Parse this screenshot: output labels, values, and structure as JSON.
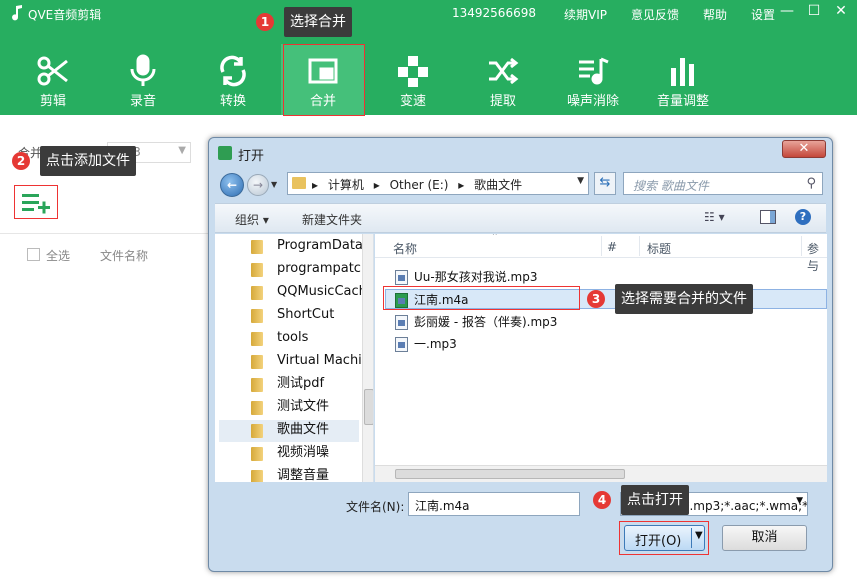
{
  "app": {
    "title": "QVE音频剪辑",
    "phone": "13492566698",
    "links": [
      "续期VIP",
      "意见反馈",
      "帮助",
      "设置"
    ],
    "win_min": "—",
    "win_max": "☐",
    "win_close": "✕"
  },
  "toolbar": {
    "items": [
      {
        "label": "剪辑",
        "icon": "scissors-icon"
      },
      {
        "label": "录音",
        "icon": "microphone-icon"
      },
      {
        "label": "转换",
        "icon": "convert-icon"
      },
      {
        "label": "合并",
        "icon": "merge-icon",
        "active": true
      },
      {
        "label": "变速",
        "icon": "speed-icon"
      },
      {
        "label": "提取",
        "icon": "shuffle-icon"
      },
      {
        "label": "噪声消除",
        "icon": "noise-icon"
      },
      {
        "label": "音量调整",
        "icon": "volume-bars-icon"
      }
    ]
  },
  "left": {
    "format_label": "合并输出格式",
    "format_value": "mp3",
    "select_all": "全选",
    "col_name": "文件名称"
  },
  "callouts": [
    {
      "n": "1",
      "text": "选择合并"
    },
    {
      "n": "2",
      "text": "点击添加文件"
    },
    {
      "n": "3",
      "text": "选择需要合并的文件"
    },
    {
      "n": "4",
      "text": "点击打开"
    }
  ],
  "dialog": {
    "title": "打开",
    "close": "✕",
    "address": [
      "计算机",
      "Other (E:)",
      "歌曲文件"
    ],
    "search_placeholder": "搜索 歌曲文件",
    "organize": "组织 ▾",
    "new_folder": "新建文件夹",
    "tree": [
      "ProgramData",
      "programpatch",
      "QQMusicCache",
      "ShortCut",
      "tools",
      "Virtual Machines",
      "测试pdf",
      "测试文件",
      "歌曲文件",
      "视频消噪",
      "调整音量"
    ],
    "selected_tree": "歌曲文件",
    "columns": [
      "名称",
      "#",
      "标题",
      "参与"
    ],
    "files": [
      "Uu-那女孩对我说.mp3",
      "江南.m4a",
      "彭丽媛 - 报答（伴奏).mp3",
      "一.mp3"
    ],
    "selected_file": "江南.m4a",
    "filename_label": "文件名(N):",
    "filename_value": "江南.m4a",
    "filetype_value": "音频文件 (*.mp3;*.aac;*.wma;*",
    "open": "打开(O)",
    "cancel": "取消"
  }
}
